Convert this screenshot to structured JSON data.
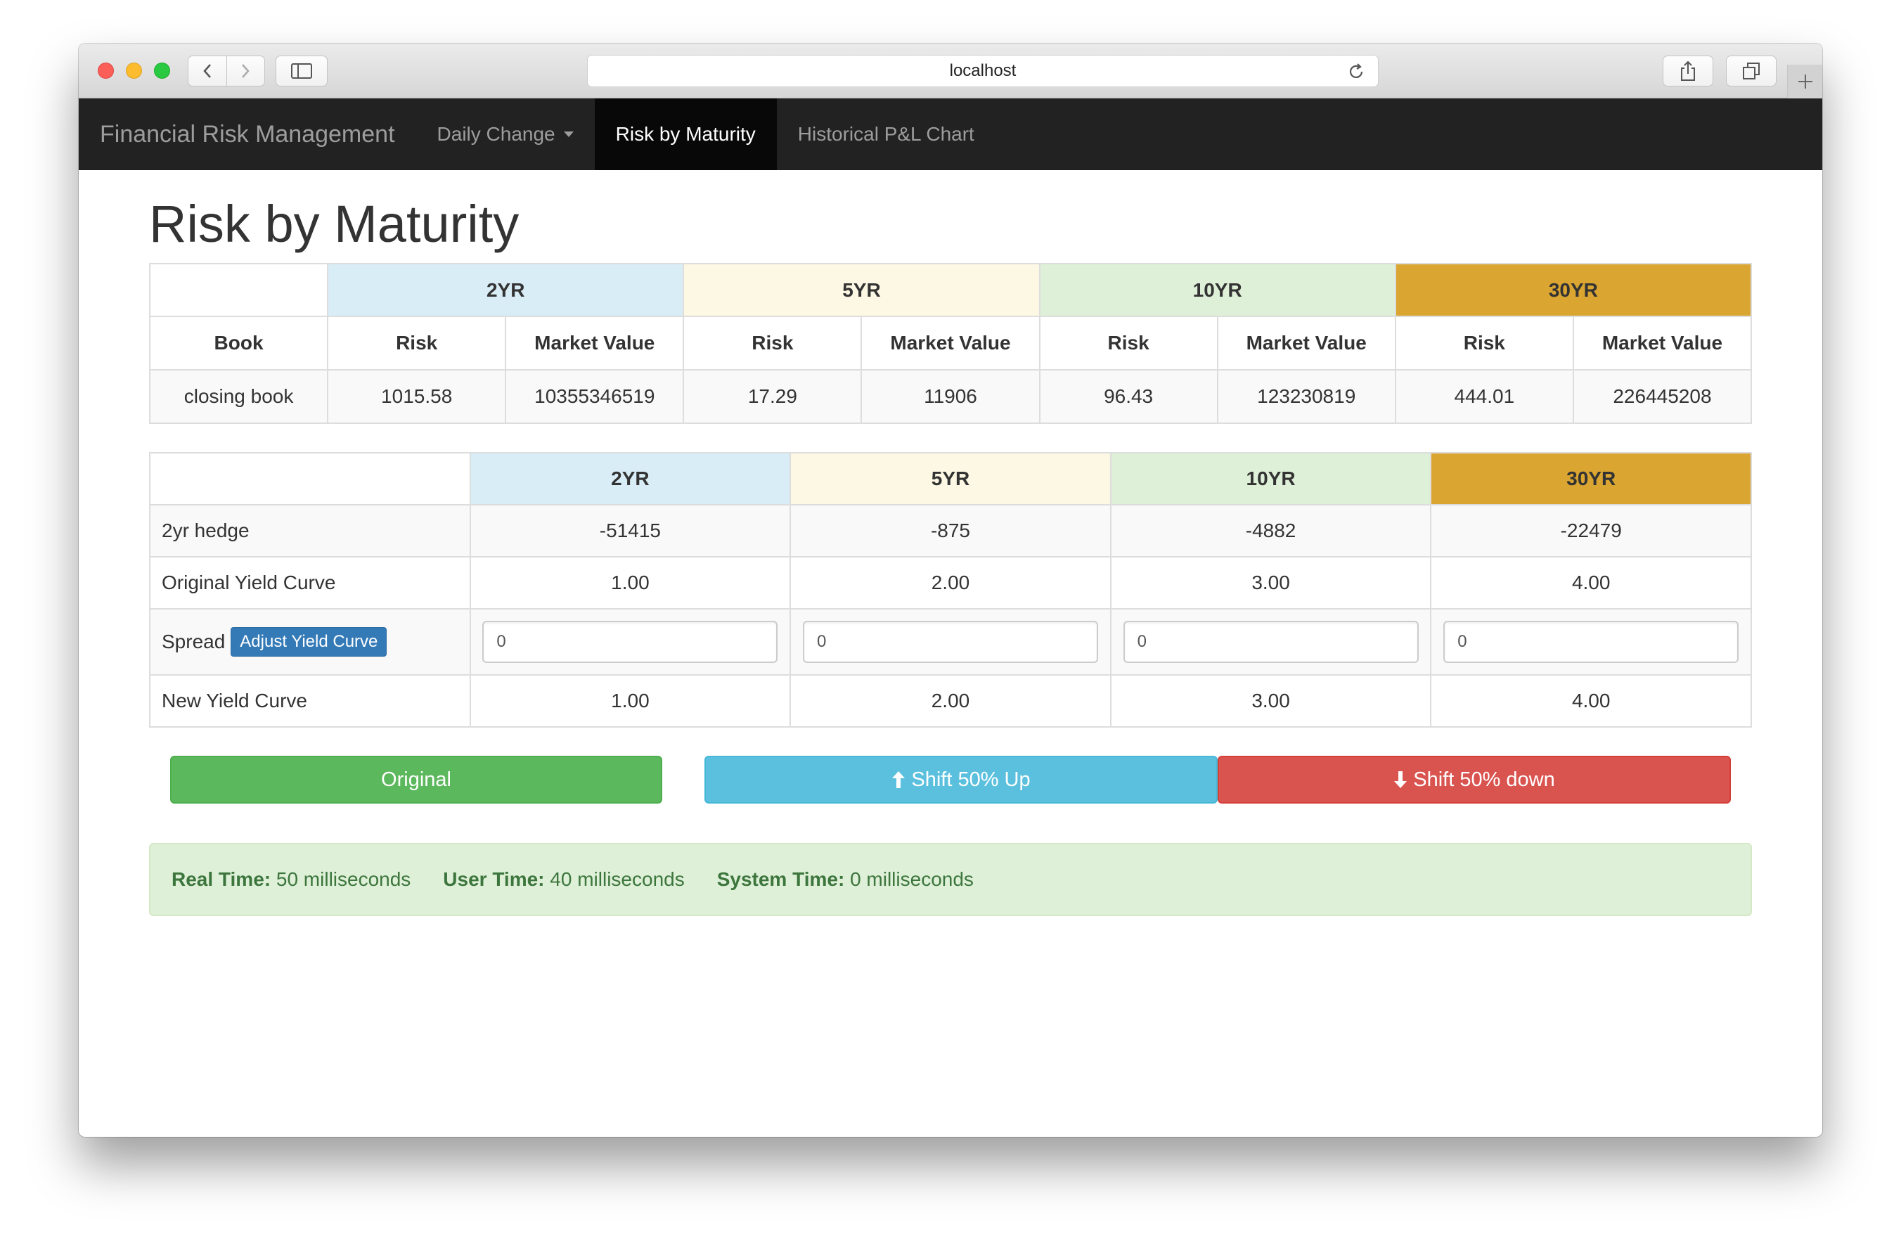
{
  "browser": {
    "url": "localhost"
  },
  "navbar": {
    "brand": "Financial Risk Management",
    "items": [
      {
        "label": "Daily Change"
      },
      {
        "label": "Risk by Maturity"
      },
      {
        "label": "Historical P&L Chart"
      }
    ]
  },
  "page": {
    "title": "Risk by Maturity"
  },
  "risk_table": {
    "tenors": [
      "2YR",
      "5YR",
      "10YR",
      "30YR"
    ],
    "subheaders": {
      "book": "Book",
      "risk": "Risk",
      "market_value": "Market Value"
    },
    "rows": [
      {
        "book": "closing book",
        "values": [
          "1015.58",
          "10355346519",
          "17.29",
          "11906",
          "96.43",
          "123230819",
          "444.01",
          "226445208"
        ]
      }
    ]
  },
  "hedge_table": {
    "tenors": [
      "2YR",
      "5YR",
      "10YR",
      "30YR"
    ],
    "hedge": {
      "label": "2yr hedge",
      "values": [
        "-51415",
        "-875",
        "-4882",
        "-22479"
      ]
    },
    "original": {
      "label": "Original Yield Curve",
      "values": [
        "1.00",
        "2.00",
        "3.00",
        "4.00"
      ]
    },
    "spread": {
      "label": "Spread",
      "button": "Adjust Yield Curve",
      "values": [
        "0",
        "0",
        "0",
        "0"
      ]
    },
    "new_curve": {
      "label": "New Yield Curve",
      "values": [
        "1.00",
        "2.00",
        "3.00",
        "4.00"
      ]
    }
  },
  "buttons": {
    "original": "Original",
    "shift_up": "Shift 50% Up",
    "shift_down": "Shift 50% down"
  },
  "timing": {
    "real_label": "Real Time:",
    "real_value": "50 milliseconds",
    "user_label": "User Time:",
    "user_value": "40 milliseconds",
    "system_label": "System Time:",
    "system_value": "0 milliseconds"
  },
  "colors": {
    "tenor_2yr": "#d9edf7",
    "tenor_5yr": "#fcf8e3",
    "tenor_10yr": "#dff0d8",
    "tenor_30yr": "#daa531",
    "navbar": "#222222",
    "success": "#5cb85c",
    "info": "#5bc0de",
    "danger": "#d9534f"
  },
  "icons": [
    "back-icon",
    "forward-icon",
    "sidebar-icon",
    "reload-icon",
    "share-icon",
    "tabs-icon",
    "plus-icon",
    "caret-down-icon",
    "arrow-up-icon",
    "arrow-down-icon"
  ]
}
